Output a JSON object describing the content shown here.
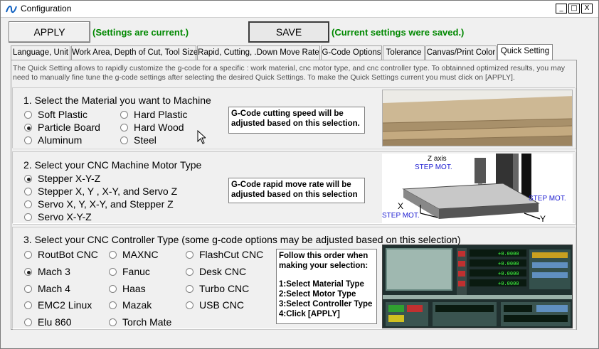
{
  "window": {
    "title": "Configuration",
    "controls": {
      "minimize": "_",
      "maximize": "□",
      "close": "X"
    }
  },
  "toolbar": {
    "apply_label": "APPLY",
    "apply_status": "(Settings are current.)",
    "save_label": "SAVE",
    "save_status": "(Current settings were saved.)"
  },
  "tabs": [
    {
      "label": "Language, Unit"
    },
    {
      "label": "Work Area, Depth of Cut, Tool Size"
    },
    {
      "label": "Rapid, Cutting, .Down Move Rate"
    },
    {
      "label": "G-Code Options"
    },
    {
      "label": "Tolerance"
    },
    {
      "label": "Canvas/Print Color"
    },
    {
      "label": "Quick Setting"
    }
  ],
  "active_tab": "Quick Setting",
  "description": "The Quick Setting allows to rapidly customize the g-code for a specific : work material, cnc motor type, and cnc controller type. To obtainned optimized results, you may need to manually  fine tune the g-code settings after selecting the desired Quick Settings. To make the Quick Settings current you must click on [APPLY].",
  "material": {
    "title": "1. Select the Material you want  to Machine",
    "options": [
      "Soft Plastic",
      "Hard Plastic",
      "Particle Board",
      "Hard Wood",
      "Aluminum",
      "Steel"
    ],
    "selected": "Particle Board",
    "info": "G-Code cutting speed will be adjusted based on this selection."
  },
  "motor": {
    "title": "2. Select your CNC Machine Motor Type",
    "options": [
      "Stepper X-Y-Z",
      "Stepper X, Y , X-Y, and Servo Z",
      "Servo X, Y, X-Y, and Stepper Z",
      "Servo X-Y-Z"
    ],
    "selected": "Stepper X-Y-Z",
    "info": "G-Code rapid move rate will be adjusted based on this selection",
    "diagram": {
      "z_axis": "Z axis",
      "step_mot_z": "STEP MOT.",
      "step_mot_y": "STEP MOT.",
      "step_mot_x": "STEP MOT.",
      "x_label": "X",
      "y_label": "Y"
    }
  },
  "controller": {
    "title": "3. Select your CNC Controller Type (some g-code options may be adjusted based on this selection)",
    "options": [
      "RoutBot CNC",
      "MAXNC",
      "FlashCut CNC",
      "Mach 3",
      "Fanuc",
      "Desk CNC",
      "Mach 4",
      "Haas",
      "Turbo CNC",
      "EMC2 Linux",
      "Mazak",
      "USB CNC",
      "Elu 860",
      "Torch Mate"
    ],
    "selected": "Mach 3",
    "instructions": {
      "intro": "Follow this order when making your selection:",
      "step1": "1:Select Material Type",
      "step2": "2:Select Motor Type",
      "step3": "3:Select Controller Type",
      "step4": "4:Click [APPLY]"
    },
    "screenshot_values": [
      "+0.0000",
      "+0.0000",
      "+0.0000",
      "+0.0000"
    ]
  },
  "colors": {
    "status_green": "#008800",
    "diagram_blue": "#1a1ad0",
    "board_tan": "#c9b08a"
  }
}
